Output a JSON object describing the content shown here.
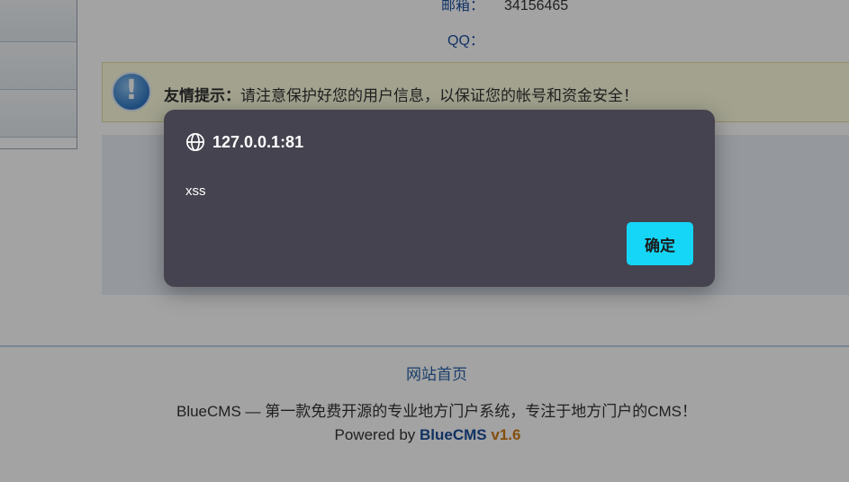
{
  "profile": {
    "email_label": "邮箱：",
    "email_value": "34156465",
    "qq_label": "QQ："
  },
  "notice": {
    "icon": "exclamation-icon",
    "title": "友情提示：",
    "message": "请注意保护好您的用户信息，以保证您的帐号和资金安全！"
  },
  "footer": {
    "home_link": "网站首页",
    "description": "BlueCMS — 第一款免费开源的专业地方门户系统，专注于地方门户的CMS！",
    "powered_prefix": "Powered by",
    "brand": "BlueCMS",
    "version": "v1.6"
  },
  "dialog": {
    "icon": "globe-icon",
    "origin": "127.0.0.1:81",
    "message": "xss",
    "ok_label": "确定",
    "colors": {
      "background": "#45434f",
      "button": "#15d6f7"
    }
  }
}
